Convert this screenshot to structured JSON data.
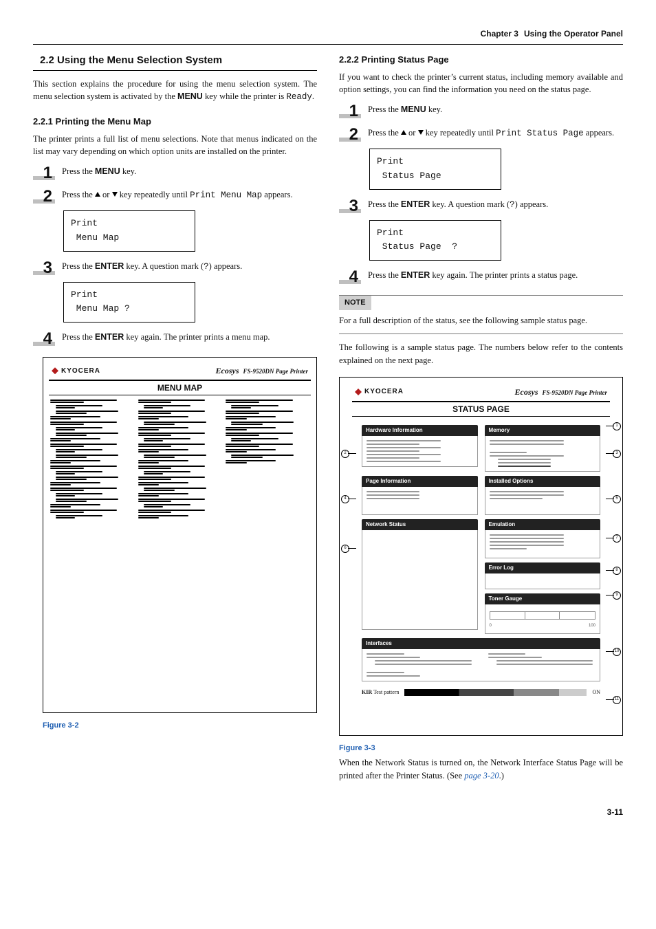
{
  "header": {
    "chapter_label": "Chapter 3",
    "chapter_title": "Using the Operator Panel"
  },
  "left": {
    "section_number": "2.2",
    "section_title": "Using the Menu Selection System",
    "intro_pre": "This section explains the procedure for using the menu selection system. The menu selection system is activated by the ",
    "intro_key": "MENU",
    "intro_post": " key while the printer is ",
    "intro_mono": "Ready",
    "intro_tail": ".",
    "sub1_title": "2.2.1 Printing the Menu Map",
    "sub1_intro": "The printer prints a full list of menu selections. Note that menus indicated on the list may vary depending on which option units are installed on the printer.",
    "step1_pre": "Press the ",
    "step1_key": "MENU",
    "step1_post": " key.",
    "step2_pre": "Press the ",
    "step2_mid": " or ",
    "step2_post1": " key repeatedly until ",
    "step2_mono": "Print Menu Map",
    "step2_post2": " appears.",
    "lcd1_line1": "Print",
    "lcd1_line2": " Menu Map",
    "step3_pre": "Press the ",
    "step3_key": "ENTER",
    "step3_mid": " key. A question mark (",
    "step3_mono": "?",
    "step3_post": ") appears.",
    "lcd2_line1": "Print",
    "lcd2_line2": " Menu Map ?",
    "step4_pre": "Press the ",
    "step4_key": "ENTER",
    "step4_post": " key again. The printer prints a menu map.",
    "figure": {
      "brand": "KYOCERA",
      "ecosys": "Ecosys",
      "model": "FS-9520DN  Page Printer",
      "doc_title": "MENU MAP",
      "caption": "Figure 3-2"
    }
  },
  "right": {
    "sub2_title": "2.2.2 Printing Status Page",
    "sub2_intro": "If you want to check the printer’s current status, including memory available and option settings, you can find the information you need on the status page.",
    "step1_pre": "Press the ",
    "step1_key": "MENU",
    "step1_post": " key.",
    "step2_pre": "Press the ",
    "step2_mid": " or ",
    "step2_post1": " key repeatedly until ",
    "step2_mono": "Print Status Page",
    "step2_post2": " appears.",
    "lcd1_line1": "Print",
    "lcd1_line2": " Status Page",
    "step3_pre": "Press the ",
    "step3_key": "ENTER",
    "step3_mid": " key. A question mark (",
    "step3_mono": "?",
    "step3_post": ") appears.",
    "lcd2_line1": "Print",
    "lcd2_line2": " Status Page  ?",
    "step4_pre": "Press the ",
    "step4_key": "ENTER",
    "step4_post": " key again. The printer prints a status page.",
    "note_label": "NOTE",
    "note_body": "For a full description of the status, see the following sample status page.",
    "below_note": "The following is a sample status page. The numbers below refer to the contents explained on the next page.",
    "figure": {
      "brand": "KYOCERA",
      "ecosys": "Ecosys",
      "model": "FS-9520DN  Page Printer",
      "doc_title": "STATUS PAGE",
      "panels": {
        "hw": "Hardware Information",
        "mem": "Memory",
        "page": "Page Information",
        "opts": "Installed Options",
        "net": "Network Status",
        "emu": "Emulation",
        "err": "Error Log",
        "toner": "Toner Gauge",
        "ifaces": "Interfaces"
      },
      "gauge": {
        "min": "0",
        "max": "100"
      },
      "kir_label_bold": "KIR",
      "kir_label_rest": " Test pattern",
      "kir_value": "ON",
      "callouts": [
        "1",
        "2",
        "3",
        "4",
        "5",
        "6",
        "7",
        "8",
        "9",
        "10",
        "11"
      ],
      "caption": "Figure 3-3",
      "caption_body_pre": "When the Network Status is turned on, the Network Interface Status Page will be printed after the Printer Status. (See ",
      "caption_link": "page 3-20",
      "caption_body_post": ".)"
    }
  },
  "footer": {
    "page_number": "3-11"
  }
}
